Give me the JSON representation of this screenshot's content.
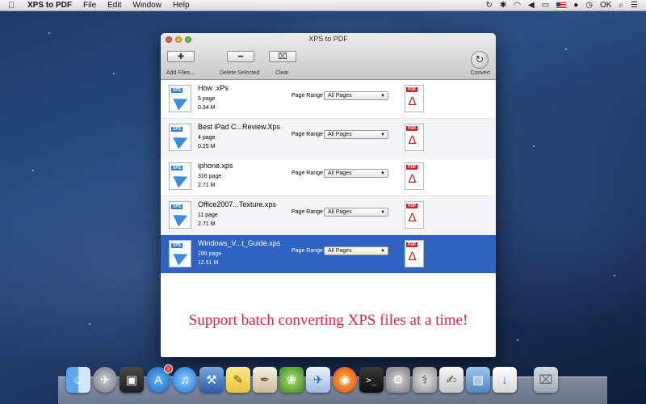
{
  "menubar": {
    "app_name": "XPS to PDF",
    "menus": [
      "File",
      "Edit",
      "Window",
      "Help"
    ],
    "status_ok": "OK"
  },
  "window": {
    "title": "XPS to PDF",
    "toolbar": {
      "add_label": "Add Files...",
      "delete_label": "Delete Selected",
      "clear_label": "Clear",
      "convert_label": "Convert"
    },
    "files": [
      {
        "name": "How .xPs",
        "pages": "5 page",
        "size": "0.34 M",
        "range_label": "Page Range",
        "range_value": "All Pages"
      },
      {
        "name": "Best iPad C...Review.Xps",
        "pages": "4 page",
        "size": "0.25 M",
        "range_label": "Page Range",
        "range_value": "All Pages"
      },
      {
        "name": "iphone.xps",
        "pages": "316 page",
        "size": "2.71 M",
        "range_label": "Page Range",
        "range_value": "All Pages"
      },
      {
        "name": "Office2007...Texture.xps",
        "pages": "11 page",
        "size": "2.71 M",
        "range_label": "Page Range",
        "range_value": "All Pages"
      },
      {
        "name": "Windows_V...t_Guide.xps",
        "pages": "299 page",
        "size": "12.51 M",
        "range_label": "Page Range",
        "range_value": "All Pages"
      }
    ],
    "selected_index": 4,
    "icon_xps_tag": "XPS",
    "icon_pdf_tag": "PDF",
    "promo": "Support batch converting XPS files at a time!"
  },
  "dock": {
    "app_store_badge": "3",
    "icons": [
      "finder-icon",
      "launchpad-icon",
      "photo-booth-icon",
      "app-store-icon",
      "itunes-icon",
      "xcode-icon",
      "stickies-icon",
      "script-editor-icon",
      "growl-icon",
      "xps-to-pdf-icon",
      "firefox-icon",
      "terminal-icon",
      "system-preferences-icon",
      "disk-utility-icon",
      "preview-icon",
      "iphoto-icon",
      "pdf-download-icon",
      "trash-icon"
    ]
  },
  "colors": {
    "selection": "#2f63c3",
    "promo_text": "#e0224a",
    "row_alt": "#f3f5f9"
  }
}
